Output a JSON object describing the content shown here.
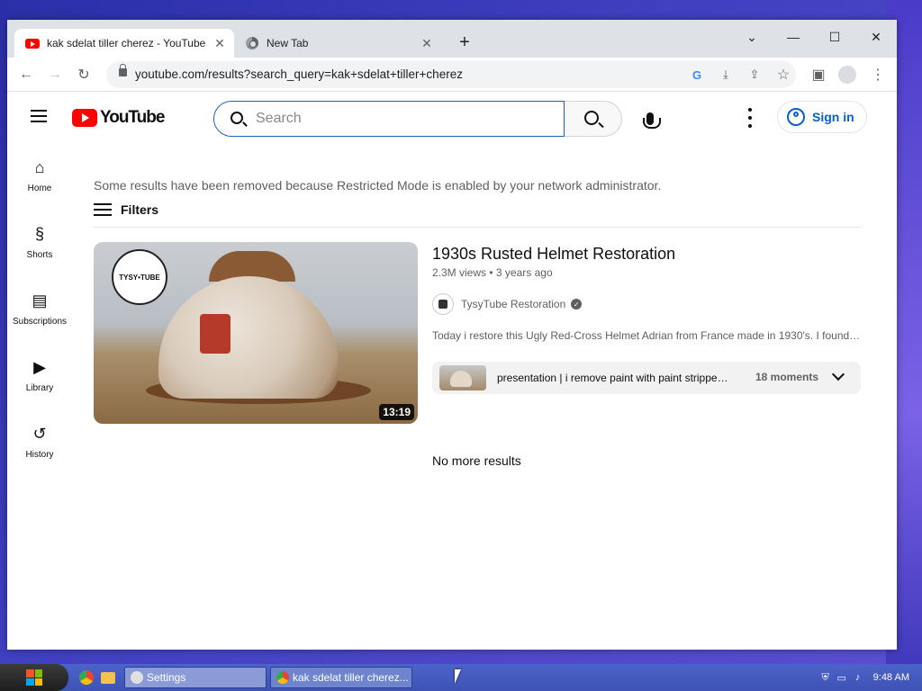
{
  "browser": {
    "tabs": [
      {
        "title": "kak sdelat tiller cherez - YouTube",
        "active": true,
        "favicon": "youtube-icon"
      },
      {
        "title": "New Tab",
        "active": false,
        "favicon": "chrome-icon"
      }
    ],
    "url": "youtube.com/results?search_query=kak+sdelat+tiller+cherez",
    "icons": {
      "back": "←",
      "forward": "→",
      "reload": "↻",
      "new_tab": "+",
      "minimize": "—",
      "maximize": "☐",
      "close": "✕",
      "tab_list": "⌄",
      "bookmark": "☆",
      "side_panel": "▣",
      "kebab": "⋮",
      "google": "G",
      "download": "⤓",
      "share": "⇪"
    }
  },
  "youtube": {
    "logo_text": "YouTube",
    "search_placeholder": "Search",
    "signin_label": "Sign in",
    "guide": [
      {
        "label": "Home",
        "icon": "⌂"
      },
      {
        "label": "Shorts",
        "icon": "§"
      },
      {
        "label": "Subscriptions",
        "icon": "▤"
      },
      {
        "label": "Library",
        "icon": "▶"
      },
      {
        "label": "History",
        "icon": "↺"
      }
    ],
    "restricted_notice": "Some results have been removed because Restricted Mode is enabled by your network administrator.",
    "filters_label": "Filters",
    "results": [
      {
        "title": "1930s Rusted Helmet Restoration",
        "views": "2.3M views",
        "age": "3 years ago",
        "meta_separator": " • ",
        "channel": "TysyTube Restoration",
        "verified": true,
        "description": "Today i restore this Ugly Red-Cross Helmet Adrian from France made in 1930's. I found this helmet in the flea market",
        "duration": "13:19",
        "thumbnail_badge": "TYSY•TUBE",
        "chapters_text": "presentation | i remove paint with paint stripper | now we remove the rust",
        "chapters_count": "18 moments"
      }
    ],
    "end_text": "No more results"
  },
  "taskbar": {
    "buttons": [
      {
        "label": "Settings"
      },
      {
        "label": "kak sdelat tiller cherez..."
      }
    ],
    "clock": "9:48 AM"
  },
  "colors": {
    "youtube_red": "#ff0000",
    "link_blue": "#065fd4",
    "taskbar": "#4c63c9"
  }
}
